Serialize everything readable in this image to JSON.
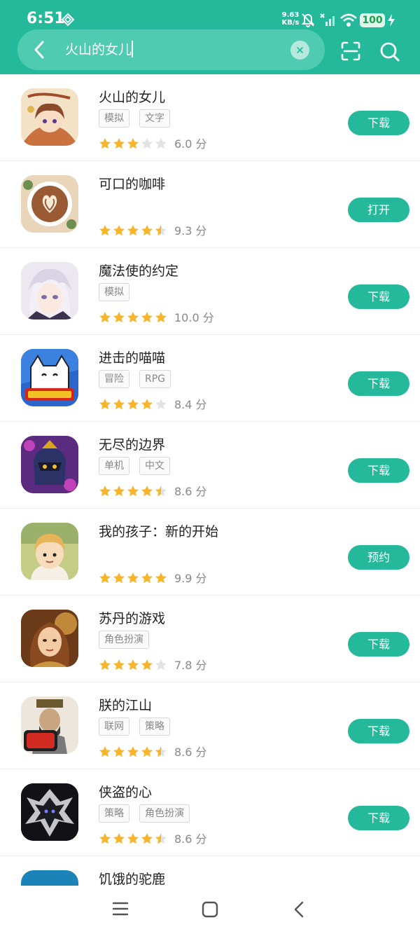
{
  "status_bar": {
    "time": "6:51",
    "net_speed_value": "9.63",
    "net_speed_unit": "KB/s",
    "battery": "100"
  },
  "search": {
    "query": "火山的女儿"
  },
  "apps": [
    {
      "name": "火山的女儿",
      "tags": [
        "模拟",
        "文字"
      ],
      "stars": 3,
      "score": "6.0 分",
      "action": "下载"
    },
    {
      "name": "可口的咖啡",
      "tags": [],
      "stars": 4.5,
      "score": "9.3 分",
      "action": "打开"
    },
    {
      "name": "魔法使的约定",
      "tags": [
        "模拟"
      ],
      "stars": 5,
      "score": "10.0 分",
      "action": "下载"
    },
    {
      "name": "进击的喵喵",
      "tags": [
        "冒险",
        "RPG"
      ],
      "stars": 4,
      "score": "8.4 分",
      "action": "下载"
    },
    {
      "name": "无尽的边界",
      "tags": [
        "单机",
        "中文"
      ],
      "stars": 4.5,
      "score": "8.6 分",
      "action": "下载"
    },
    {
      "name": "我的孩子：新的开始",
      "tags": [],
      "stars": 5,
      "score": "9.9 分",
      "action": "预约"
    },
    {
      "name": "苏丹的游戏",
      "tags": [
        "角色扮演"
      ],
      "stars": 4,
      "score": "7.8 分",
      "action": "下载"
    },
    {
      "name": "朕的江山",
      "tags": [
        "联网",
        "策略"
      ],
      "stars": 4.5,
      "score": "8.6 分",
      "action": "下载"
    },
    {
      "name": "侠盗的心",
      "tags": [
        "策略",
        "角色扮演"
      ],
      "stars": 4.5,
      "score": "8.6 分",
      "action": "下载"
    },
    {
      "name": "饥饿的驼鹿",
      "tags": [],
      "stars": 0,
      "score": "",
      "action": ""
    }
  ],
  "icons": {
    "back": "back-arrow-icon",
    "scan": "scan-icon",
    "search": "search-icon",
    "clear": "clear-icon",
    "nav_menu": "menu-icon",
    "nav_home": "home-icon",
    "nav_back": "back-icon"
  },
  "colors": {
    "accent": "#23b99a",
    "star_on": "#f7b52c",
    "star_off": "#e3e3e3"
  }
}
